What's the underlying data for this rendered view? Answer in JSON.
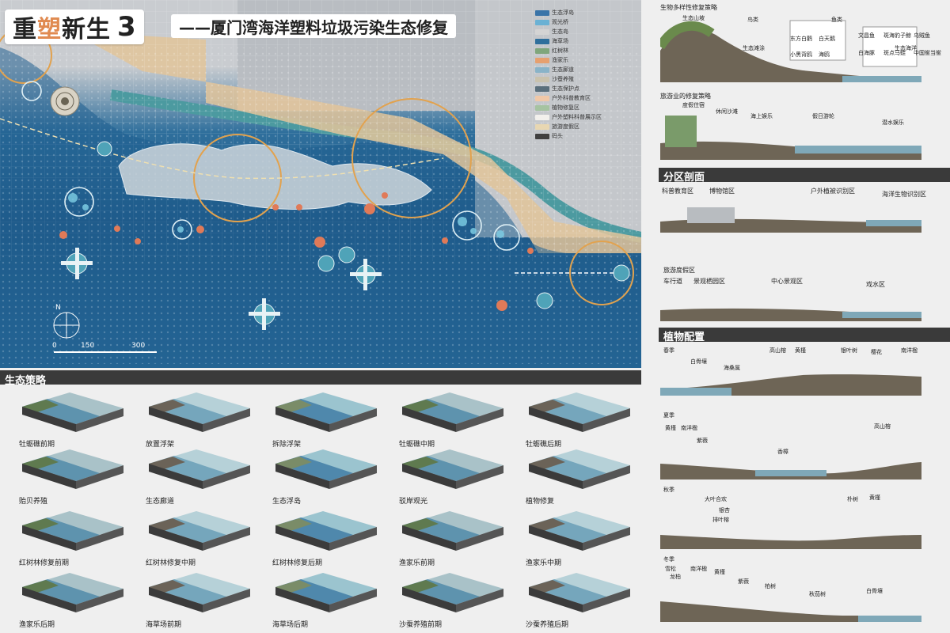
{
  "title": {
    "main_a": "重",
    "main_b": "塑",
    "main_c": "新生",
    "number": "3",
    "subtitle": "——厦门湾海洋塑料垃圾污染生态修复"
  },
  "legend": [
    {
      "label": "生态浮岛",
      "color": "#3a74a8"
    },
    {
      "label": "观光桥",
      "color": "#6ab1d4"
    },
    {
      "label": "生态岛",
      "color": "#d4d4d4"
    },
    {
      "label": "海草场",
      "color": "#2f6f9c"
    },
    {
      "label": "红树林",
      "color": "#7fa67c"
    },
    {
      "label": "渔家乐",
      "color": "#e6a06f"
    },
    {
      "label": "生态廊道",
      "color": "#89b3c8"
    },
    {
      "label": "沙蚕养殖",
      "color": "#c9c2ad"
    },
    {
      "label": "生态保护点",
      "color": "#5a6f7c"
    },
    {
      "label": "户外科普教育区",
      "color": "#f0c8a8"
    },
    {
      "label": "植物修复区",
      "color": "#a6c3a1"
    },
    {
      "label": "户外塑料科普展示区",
      "color": "#f2f0ec"
    },
    {
      "label": "旅游度假区",
      "color": "#e8d7b2"
    },
    {
      "label": "码头",
      "color": "#404040"
    }
  ],
  "compass": {
    "label": "N"
  },
  "scale": {
    "t0": "0",
    "t1": "150",
    "t2": "300"
  },
  "strategy": {
    "title": "生态策略",
    "tiles": [
      "牡蛎礁前期",
      "放置浮架",
      "拆除浮架",
      "牡蛎礁中期",
      "牡蛎礁后期",
      "贻贝养殖",
      "生态廊道",
      "生态浮岛",
      "驳岸观光",
      "植物修复",
      "红树林修复前期",
      "红树林修复中期",
      "红树林修复后期",
      "渔家乐前期",
      "渔家乐中期",
      "渔家乐后期",
      "海草场前期",
      "海草场后期",
      "沙蚕养殖前期",
      "沙蚕养殖后期"
    ]
  },
  "right": {
    "biodiversity": {
      "title": "生物多样性修复策略",
      "labels": [
        "生态山坡",
        "鸟类",
        "鱼类",
        "生态滩涂",
        "生态海洋"
      ],
      "birds": [
        "东方白鹳",
        "白天鹅",
        "小黑背鸥",
        "海鸥"
      ],
      "fish": [
        "文昌鱼",
        "斑海豹子鲸",
        "乌贼鱼",
        "白海豚",
        "斑点马蛙",
        "中国鲎当鲎"
      ]
    },
    "tourism": {
      "title": "旅游业的修复策略",
      "labels": [
        "度假住宿",
        "休闲沙滩",
        "海上娱乐",
        "假日游轮",
        "潜水娱乐"
      ]
    },
    "zone": {
      "title": "分区剖面",
      "row1": [
        "科普教育区",
        "博物馆区",
        "户外植被识别区",
        "海洋生物识别区"
      ],
      "row2": [
        "旅游度假区",
        "车行道",
        "景观栖园区",
        "中心景观区",
        "戏水区"
      ]
    },
    "plant": {
      "title": "植物配置",
      "spring": {
        "season": "春季",
        "labels": [
          "白骨壤",
          "海桑属",
          "高山榕",
          "黄槿",
          "银叶树",
          "樱花",
          "南洋楹"
        ]
      },
      "summer": {
        "season": "夏季",
        "labels": [
          "黄槿",
          "南洋楹",
          "紫薇",
          "香樟",
          "高山榕"
        ]
      },
      "autumn": {
        "season": "秋季",
        "labels": [
          "大叶合欢",
          "银杏",
          "朴树",
          "黄槿",
          "排叶榕"
        ]
      },
      "winter": {
        "season": "冬季",
        "labels": [
          "雪松",
          "龙柏",
          "南洋楹",
          "黄槿",
          "紫薇",
          "柏树",
          "秋茄树",
          "白骨壤"
        ]
      }
    }
  }
}
